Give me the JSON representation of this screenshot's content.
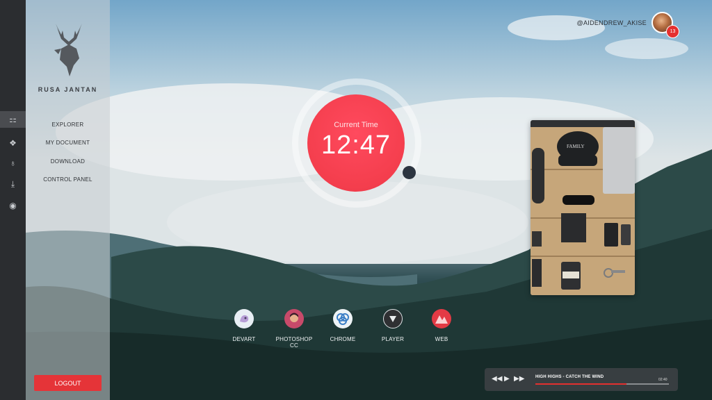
{
  "brand": {
    "name": "RUSA JANTAN",
    "logo_icon": "deer-head-logo-icon"
  },
  "rail": [
    {
      "icon": "grid-icon",
      "glyph": "⚏",
      "active": true
    },
    {
      "icon": "fox-icon",
      "glyph": "❖",
      "active": false
    },
    {
      "icon": "lightbulb-icon",
      "glyph": "♁",
      "active": false
    },
    {
      "icon": "download-icon",
      "glyph": "⤓",
      "active": false
    },
    {
      "icon": "target-icon",
      "glyph": "◉",
      "active": false
    }
  ],
  "nav": [
    {
      "label": "EXPLORER"
    },
    {
      "label": "MY DOCUMENT"
    },
    {
      "label": "DOWNLOAD"
    },
    {
      "label": "CONTROL PANEL"
    }
  ],
  "logout_label": "LOGOUT",
  "user": {
    "handle": "@AIDENDREW_AKISE",
    "notifications": "13"
  },
  "clock": {
    "label": "Current Time",
    "time": "12:47"
  },
  "dock": [
    {
      "label": "DEVART",
      "icon": "devart-icon"
    },
    {
      "label": "PHOTOSHOP CC",
      "icon": "photoshop-icon"
    },
    {
      "label": "CHROME",
      "icon": "chrome-icon"
    },
    {
      "label": "PLAYER",
      "icon": "player-icon"
    },
    {
      "label": "WEB",
      "icon": "web-icon"
    }
  ],
  "player": {
    "track": "HIGH HIGHS - CATCH THE WIND",
    "time": "02:40",
    "progress": 0.68
  },
  "colors": {
    "accent": "#e5302f",
    "clock": "#f43e4d"
  }
}
